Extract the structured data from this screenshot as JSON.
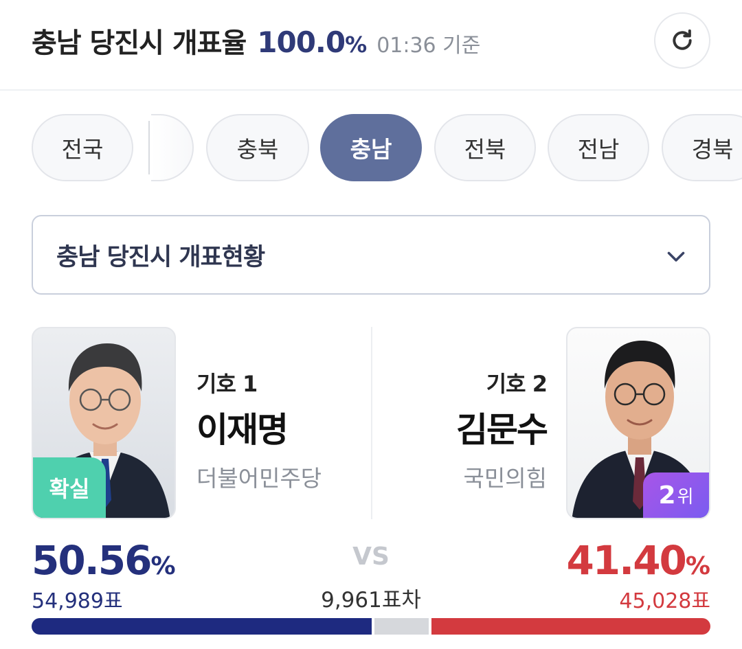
{
  "header": {
    "title": "충남 당진시 개표율",
    "rate_value": "100.0",
    "rate_unit": "%",
    "base_time": "01:36 기준",
    "refresh_icon": "refresh-icon"
  },
  "regions": {
    "items": [
      "전국",
      "충북",
      "충남",
      "전북",
      "전남",
      "경북"
    ],
    "selected": "충남"
  },
  "dropdown": {
    "label": "충남 당진시 개표현황",
    "icon": "chevron-down-icon"
  },
  "candidates": [
    {
      "number": "기호 1",
      "name": "이재명",
      "party": "더불어민주당",
      "badge": "확실",
      "percent": "50.56",
      "percent_unit": "%",
      "votes": "54,989표",
      "color": "#24307c"
    },
    {
      "number": "기호 2",
      "name": "김문수",
      "party": "국민의힘",
      "badge_num": "2",
      "badge_unit": "위",
      "percent": "41.40",
      "percent_unit": "%",
      "votes": "45,028표",
      "color": "#d33a3f"
    }
  ],
  "comparison": {
    "vs": "VS",
    "difference": "9,961표차"
  },
  "share_bar": {
    "left_fraction": 0.5056,
    "right_fraction": 0.414,
    "left_color": "#1e2a80",
    "other_color": "#d6d8dc",
    "right_color": "#d33a3f"
  },
  "colors": {
    "accent_navy": "#2f3a78",
    "accent_red": "#d33a3f",
    "chip_active": "#5f6f9c",
    "badge_confirmed": "#4fd0ae",
    "badge_rank": "#a855e8"
  }
}
